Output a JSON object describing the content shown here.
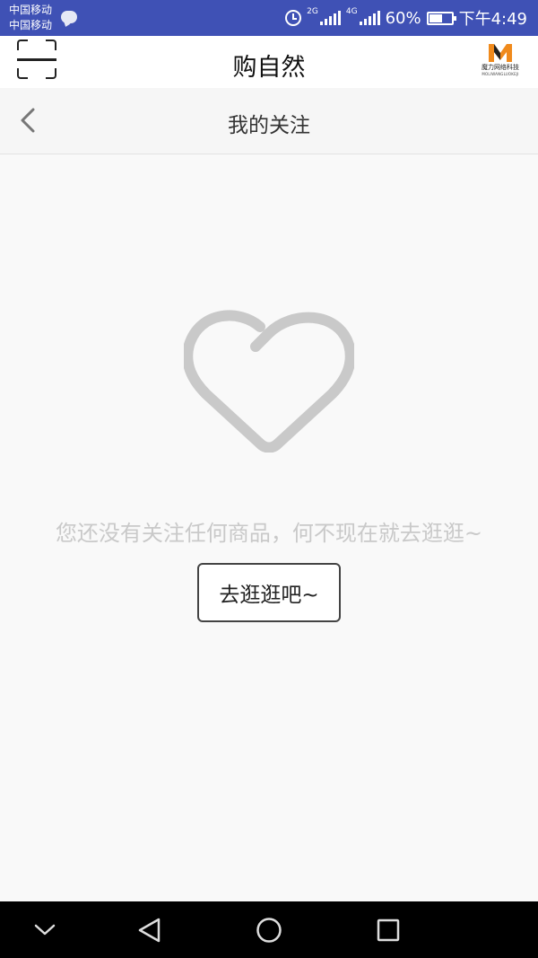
{
  "status_bar": {
    "carrier_1": "中国移动",
    "carrier_2": "中国移动",
    "network_1": "2G",
    "network_2": "4G",
    "battery_percent": "60%",
    "battery_level": 0.6,
    "time": "下午4:49",
    "bg_color": "#3f51b5"
  },
  "app_header": {
    "title": "购自然",
    "scan_icon": "scan-icon",
    "logo_text": "魔力网络科技",
    "logo_sub": "MOLIWANGLUOKEJI",
    "logo_color": "#f08a1c"
  },
  "page_header": {
    "title": "我的关注",
    "back_icon": "chevron-left-icon"
  },
  "empty_state": {
    "icon": "heart-icon",
    "message": "您还没有关注任何商品，何不现在就去逛逛~",
    "button_label": "去逛逛吧~"
  },
  "nav_bar": {
    "icons": [
      "chevron-down-icon",
      "back-triangle-icon",
      "home-circle-icon",
      "recents-square-icon"
    ]
  }
}
